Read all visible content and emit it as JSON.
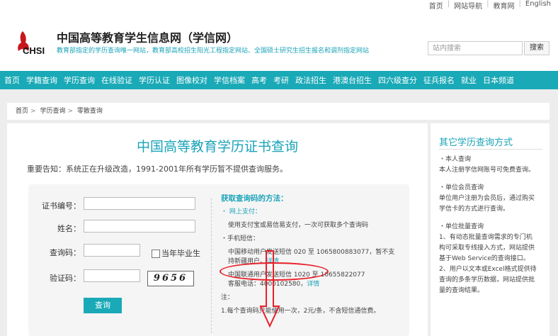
{
  "toplinks": [
    "首页",
    "网站导航",
    "教育网",
    "English"
  ],
  "header": {
    "logo_text": "CHSI",
    "title": "中国高等教育学生信息网（学信网）",
    "subtitle": "教育部指定的学历查询唯一网站，教育部高校招生阳光工程指定网站、全国硕士研究生招生报名和调剂指定网站",
    "search_placeholder": "站内搜索",
    "search_button": "搜索"
  },
  "nav": [
    "首页",
    "学籍查询",
    "学历查询",
    "在线验证",
    "学历认证",
    "图像校对",
    "学信档案",
    "高考",
    "考研",
    "政法招生",
    "港澳台招生",
    "四六级查分",
    "征兵报名",
    "就业",
    "日本频道"
  ],
  "breadcrumb": [
    "首页",
    "学历查询",
    "零散查询"
  ],
  "main": {
    "title": "中国高等教育学历证书查询",
    "notice": "重要告知：系统正在升级改造，1991-2001年所有学历暂不提供查询服务。",
    "form": {
      "cert_label": "证书编号：",
      "name_label": "姓名：",
      "code_label": "查询码：",
      "current_grad_label": "当年毕业生",
      "verify_label": "验证码：",
      "captcha": "9656",
      "submit": "查询"
    },
    "howto": {
      "title": "获取查询码的方法：",
      "online_label": "・ 网上支付：",
      "online_desc": "使用支付宝或易信易支付，一次可获取多个查询码",
      "sms_label": "・手机短信：",
      "mobile_line": "中国移动用户发送短信 020 至 1065800883077，暂不支",
      "mobile_line2": "持新疆用户。",
      "unicom_line": "中国联通用户发送短信 1020 至 10655822077",
      "hotline": "客服电话：4000102580，",
      "detail": "详情",
      "note_label": "注：",
      "note1": "1.每个查询码只能使用一次，2元/条，不含短信通信费。"
    }
  },
  "side": {
    "title": "其它学历查询方式",
    "items": [
      {
        "head": "・本人查询",
        "body": [
          "本人注册学信网账号可免费查询。"
        ]
      },
      {
        "head": "・单位会员查询",
        "body": [
          "单位用户注册为会员后，通过购买",
          "学信卡的方式进行查询。"
        ]
      },
      {
        "head": "・单位批量查询",
        "body": [
          "1、有动态批量查询需求的专门机",
          "构可采取专线接入方式，网站提供",
          "基于Web Service的查询接口。",
          "2、用户以文本或Excel格式提供待",
          "查询的多条学历数据，网站提供批",
          "量的查询结果。"
        ]
      }
    ]
  },
  "colors": {
    "accent": "#19a9b7",
    "annotation": "#e8202a"
  }
}
